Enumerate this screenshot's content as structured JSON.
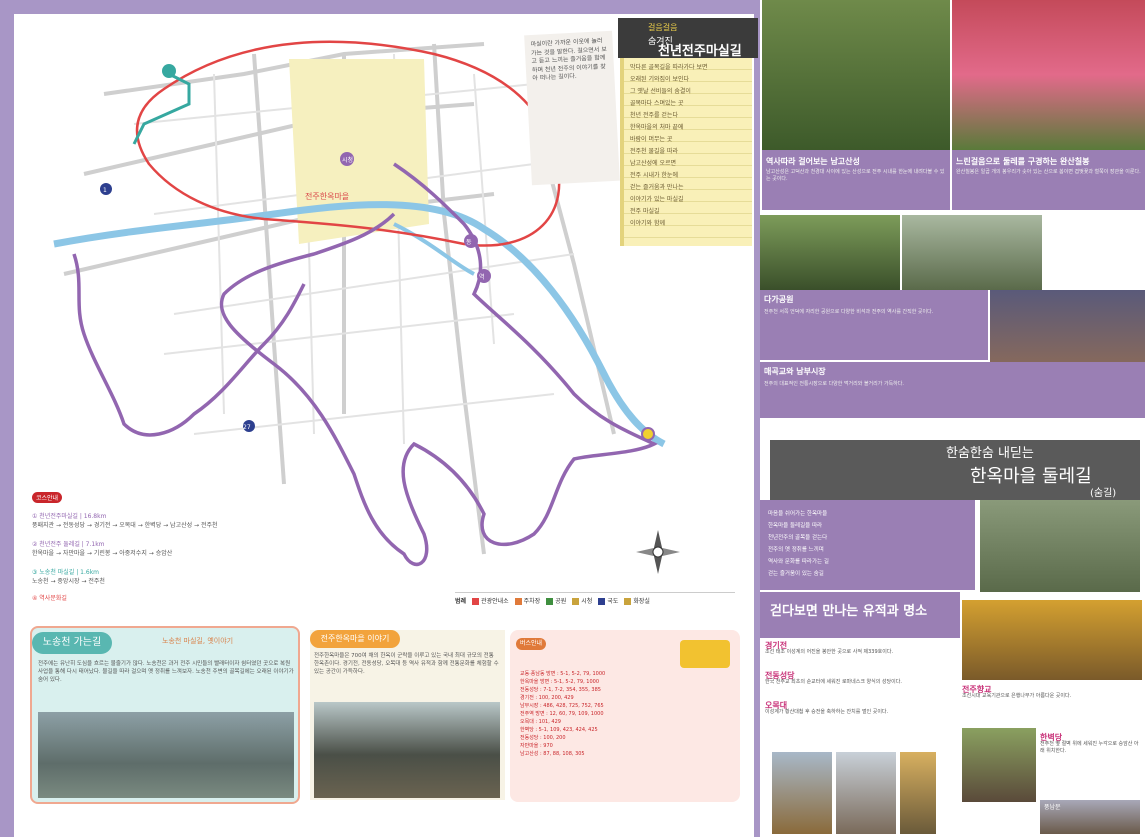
{
  "banner": {
    "small1": "걸음걸음",
    "small2": "숨겨진",
    "small3": "이야기들",
    "big": "천년전주마실길"
  },
  "note_text": "마실이란 가까운 이웃에 놀러가는 것을 말한다. 걸으면서 보고 듣고 느끼는 즐거움을 함께하며 천년 전주의 이야기를 찾아 떠나는 길이다.",
  "yellow_note": [
    "막다른 골목길을 따라가다 보면",
    "오래된 기와집이 보인다",
    "그 옛날 선비들의 숨결이",
    "골목마다 스며있는 곳",
    "천년 전주를 걷는다",
    "한옥마을의 처마 끝에",
    "바람이 머무는 곳",
    "전주천 물길을 따라",
    "남고산성에 오르면",
    "전주 시내가 한눈에",
    "걷는 즐거움과 만나는",
    "이야기가 있는 마실길",
    "전주 마실길",
    "이야기와 함께"
  ],
  "map_labels": {
    "moraejeong": "모래내",
    "dukjin": "덕진",
    "hanok": "전주한옥마을",
    "jungang": "중앙",
    "center": "시청",
    "road1": "1",
    "road27": "27",
    "hwasan": "화산",
    "east": "동",
    "station": "역"
  },
  "route_legend": {
    "badge": "코스안내",
    "c1": "① 천년전주마실길 | 16.8km",
    "c1_d": "풍패지관 → 전동성당 → 경기전 → 오목대 → 한벽당 → 남고산성 → 전주천",
    "c2": "② 천년전주 둘레길 | 7.1km",
    "c2_d": "한옥마을 → 자만마을 → 기린봉 → 아중저수지 → 승암산",
    "c3": "③ 노송천 마실길 | 1.6km",
    "c3_d": "노송천 → 중앙시장 → 전주천",
    "c4": "④ 역사문화길"
  },
  "legend_bar": {
    "label": "범례",
    "i1": "관광안내소",
    "i2": "주차장",
    "i3": "공원",
    "i4": "시청",
    "i5": "국도",
    "i6": "화장실"
  },
  "box1": {
    "tag": "노송천 가는길",
    "sub": "노송천 마실길, 옛이야기",
    "body": "전주에는 유난히 도심을 흐르는 물줄기가 많다. 노송천은 과거 전주 시민들의 빨래터이자 쉼터였던 곳으로 복원 사업을 통해 다시 태어났다. 물길을 따라 걸으며 옛 정취를 느껴보자. 노송천 주변의 골목길에는 오래된 이야기가 숨어 있다."
  },
  "box2": {
    "tag": "전주한옥마을 이야기",
    "body": "전주한옥마을은 700여 채의 한옥이 군락을 이루고 있는 국내 최대 규모의 전통 한옥촌이다. 경기전, 전동성당, 오목대 등 역사 유적과 함께 전통문화를 체험할 수 있는 공간이 가득하다."
  },
  "box3": {
    "tag": "버스안내",
    "lines": [
      "교동·풍남동 방면 : 5-1, 5-2, 79, 1000",
      "한옥마을 방면 : 5-1, 5-2, 79, 1000",
      "전동성당 : 7-1, 7-2, 354, 355, 385",
      "경기전 : 100, 200, 429",
      "남부시장 : 486, 428, 725, 752, 765",
      "전주역 방면 : 12, 60, 79, 109, 1000",
      "오목대 : 101, 429",
      "한벽당 : 5-1, 109, 423, 424, 425",
      "전동성당 : 100, 200",
      "자만마을 : 970",
      "남고산성 : 87, 88, 108, 305"
    ]
  },
  "right": {
    "sec1": "역사따라 걸어보는 남고산성",
    "sec1_body": "남고산성은 고덕산과 천경대 사이에 있는 산성으로 전주 시내를 한눈에 내려다볼 수 있는 곳이다.",
    "sec2": "느린걸음으로 둘레를 구경하는 완산칠봉",
    "sec2_body": "완산칠봉은 일곱 개의 봉우리가 솟아 있는 산으로 봄이면 겹벚꽃과 철쭉이 장관을 이룬다.",
    "sec3": "다가공원",
    "sec3_body": "전주천 서쪽 언덕에 자리한 공원으로 다양한 비석과 전주의 역사를 간직한 곳이다.",
    "sec4": "매곡교와 남부시장",
    "sec4_body": "전주의 대표적인 전통시장으로 다양한 먹거리와 볼거리가 가득하다.",
    "banner_t1": "한숨한숨 내딛는",
    "banner_t2": "한옥마을 둘레길",
    "banner_t3": "(숨길)",
    "poem": [
      "마음을 쉬어가는 한옥마을",
      "한옥마을 둘레길을 따라",
      "천년전주의 골목을 걷는다",
      "전주의 옛 정취를 느끼며",
      "역사와 문화를 따라가는 길",
      "걷는 즐거움이 있는 숨길"
    ],
    "sec5_head": "걷다보면 만나는 유적과 명소",
    "s1": "경기전",
    "s1_b": "조선 태조 이성계의 어진을 봉안한 곳으로 사적 제339호이다.",
    "s2": "전동성당",
    "s2_b": "한국 천주교 최초의 순교터에 세워진 로마네스크 양식의 성당이다.",
    "s3": "오목대",
    "s3_b": "이성계가 황산대첩 후 승전을 축하하는 잔치를 벌인 곳이다.",
    "s4": "전주향교",
    "s4_b": "조선시대 교육기관으로 은행나무가 아름다운 곳이다.",
    "s5": "한벽당",
    "s5_b": "전주천 옆 절벽 위에 세워진 누각으로 승암산 아래 위치한다.",
    "s6": "풍남문"
  }
}
